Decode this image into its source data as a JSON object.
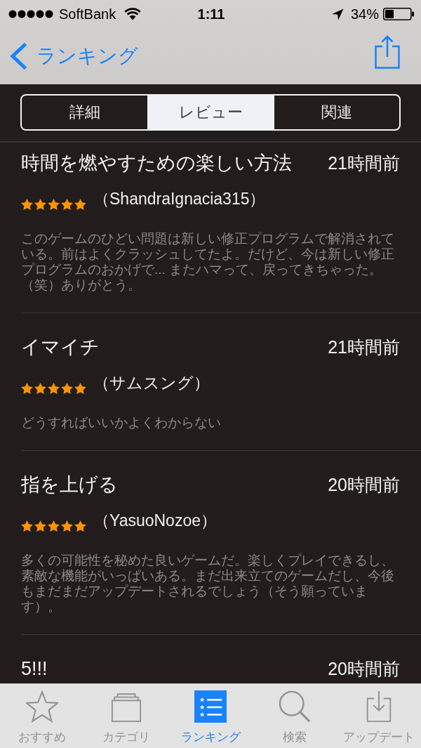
{
  "status_bar": {
    "carrier": "SoftBank",
    "time": "1:11",
    "battery": "34%"
  },
  "nav_bar": {
    "back_label": "ランキング"
  },
  "segments": [
    {
      "label": "詳細",
      "selected": false
    },
    {
      "label": "レビュー",
      "selected": true
    },
    {
      "label": "関連",
      "selected": false
    }
  ],
  "reviews": [
    {
      "title": "時間を燃やすための楽しい方法",
      "time": "21時間前",
      "stars": 5,
      "author": "（ShandraIgnacia315）",
      "body": "このゲームのひどい問題は新しい修正プログラムで解消されている。前はよくクラッシュしてたよ。だけど、今は新しい修正プログラムのおかげで... またハマって、戻ってきちゃった。（笑）ありがとう。"
    },
    {
      "title": "イマイチ",
      "time": "21時間前",
      "stars": 5,
      "author": "（サムスング）",
      "body": "どうすればいいかよくわからない"
    },
    {
      "title": "指を上げる",
      "time": "20時間前",
      "stars": 5,
      "author": "（YasuoNozoe）",
      "body": "多くの可能性を秘めた良いゲームだ。楽しくプレイできるし、素敵な機能がいっぱいある。まだ出来立てのゲームだし、今後もまだまだアップデートされるでしょう（そう願っています）。"
    },
    {
      "title": "5!!!",
      "time": "20時間前"
    }
  ],
  "tab_bar": [
    {
      "kind": "featured",
      "label": "おすすめ",
      "selected": false
    },
    {
      "kind": "categories",
      "label": "カテゴリ",
      "selected": false
    },
    {
      "kind": "ranking",
      "label": "ランキング",
      "selected": true
    },
    {
      "kind": "search",
      "label": "検索",
      "selected": false
    },
    {
      "kind": "updates",
      "label": "アップデート",
      "selected": false
    }
  ]
}
